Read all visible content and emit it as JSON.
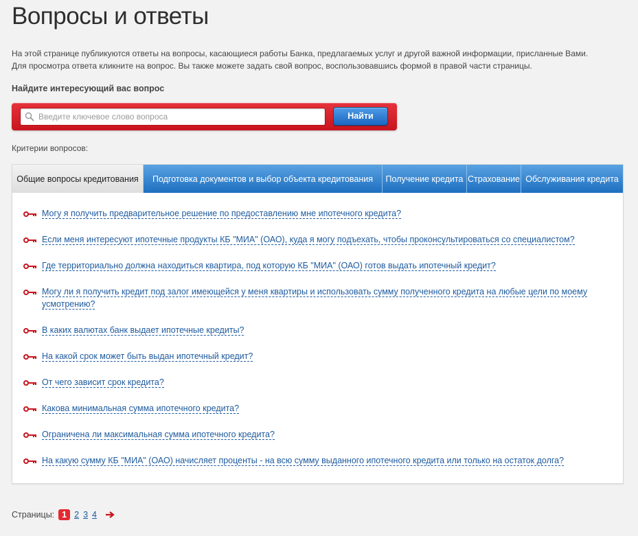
{
  "page": {
    "title": "Вопросы и ответы",
    "intro_line1": "На этой странице публикуются ответы на вопросы, касающиеся работы Банка, предлагаемых услуг и другой важной информации, присланные Вами.",
    "intro_line2": "Для просмотра ответа кликните на вопрос. Вы также можете задать свой вопрос, воспользовавшись формой в правой части страницы."
  },
  "search": {
    "heading": "Найдите интересующий вас вопрос",
    "placeholder": "Введите ключевое слово вопроса",
    "value": "",
    "button_label": "Найти"
  },
  "criteria_label": "Критерии вопросов:",
  "tabs": [
    {
      "label": "Общие вопросы кредитования",
      "active": true
    },
    {
      "label": "Подготовка документов и выбор объекта кредитования",
      "active": false
    },
    {
      "label": "Получение кредита",
      "active": false
    },
    {
      "label": "Страхование",
      "active": false
    },
    {
      "label": "Обслуживания кредита",
      "active": false
    }
  ],
  "questions": [
    "Могу я получить предварительное решение по предоставлению мне ипотечного кредита?",
    "Если меня интересуют ипотечные продукты КБ \"МИА\" (ОАО), куда я могу подъехать, чтобы проконсультироваться со специалистом?",
    "Где территориально должна находиться квартира, под которую КБ \"МИА\" (ОАО) готов выдать ипотечный кредит?",
    "Могу ли я получить кредит под залог имеющейся у меня квартиры и использовать сумму полученного кредита на любые цели по моему усмотрению?",
    "В каких валютах банк выдает ипотечные кредиты?",
    "На какой срок может быть выдан ипотечный кредит?",
    "От чего зависит срок кредита?",
    "Какова минимальная сумма ипотечного кредита?",
    "Ограничена ли максимальная сумма ипотечного кредита?",
    "На какую сумму КБ \"МИА\" (ОАО) начисляет проценты - на всю сумму выданного ипотечного кредита или только на остаток долга?"
  ],
  "pagination": {
    "label": "Страницы:",
    "pages": [
      "1",
      "2",
      "3",
      "4"
    ],
    "current": "1"
  },
  "colors": {
    "accent_red": "#e32a31",
    "link_blue": "#1d5a9e",
    "tab_blue": "#2a78c8"
  },
  "icons": {
    "search": "magnifier-icon",
    "question_bullet": "key-icon",
    "next_page": "arrow-right-icon"
  }
}
